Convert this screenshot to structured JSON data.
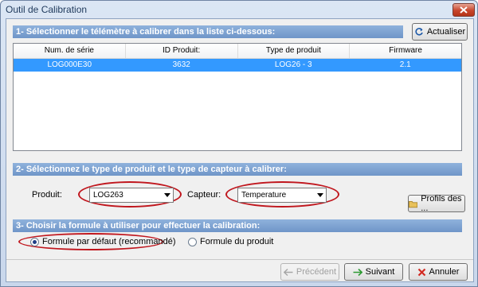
{
  "window": {
    "title": "Outil de Calibration"
  },
  "section1": {
    "header": "1- Sélectionner le télémètre à calibrer dans la liste ci-dessous:",
    "refresh_label": "Actualiser",
    "columns": [
      "Num. de série",
      "ID Produit:",
      "Type de produit",
      "Firmware"
    ],
    "rows": [
      {
        "serial": "LOG000E30",
        "id": "3632",
        "type": "LOG26 - 3",
        "firmware": "2.1"
      }
    ]
  },
  "section2": {
    "header": "2- Sélectionnez le type de produit et le type de capteur à calibrer:",
    "product_label": "Produit:",
    "product_value": "LOG263",
    "sensor_label": "Capteur:",
    "sensor_value": "Temperature",
    "profiles_label": "Profils des ..."
  },
  "section3": {
    "header": "3- Choisir la formule à utiliser pour effectuer la calibration:",
    "option_default": "Formule par défaut (recommandé)",
    "option_product": "Formule du produit",
    "selected": "default"
  },
  "footer": {
    "prev_label": "Précédent",
    "next_label": "Suivant",
    "cancel_label": "Annuler"
  },
  "colors": {
    "highlight": "#3399ff",
    "annotation_red": "#c0161d",
    "section_header": "#7aa0d0"
  }
}
